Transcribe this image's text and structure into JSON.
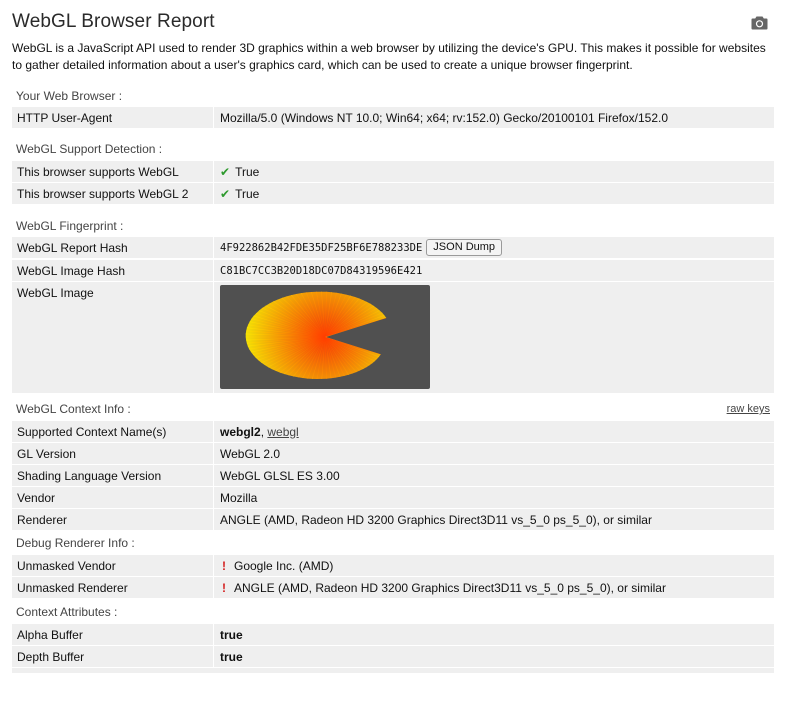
{
  "header": {
    "title": "WebGL Browser Report",
    "camera_icon": "camera-icon",
    "intro": "WebGL is a JavaScript API used to render 3D graphics within a web browser by utilizing the device's GPU. This makes it possible for websites to gather detailed information about a user's graphics card, which can be used to create a unique browser fingerprint."
  },
  "browser": {
    "section": "Your Web Browser :",
    "ua_label": "HTTP User-Agent",
    "ua_value": "Mozilla/5.0 (Windows NT 10.0; Win64; x64; rv:152.0) Gecko/20100101 Firefox/152.0"
  },
  "support": {
    "section": "WebGL Support Detection :",
    "rows": [
      {
        "label": "This browser supports WebGL",
        "check": "✔",
        "value": "True"
      },
      {
        "label": "This browser supports WebGL 2",
        "check": "✔",
        "value": "True"
      }
    ]
  },
  "fingerprint": {
    "section": "WebGL Fingerprint :",
    "report_hash_label": "WebGL Report Hash",
    "report_hash_value": "4F922862B42FDE35DF25BF6E788233DE",
    "json_dump_label": "JSON Dump",
    "image_hash_label": "WebGL Image Hash",
    "image_hash_value": "C81BC7CC3B20D18DC07D84319596E421",
    "image_label": "WebGL Image"
  },
  "context": {
    "section": "WebGL Context Info :",
    "raw_keys": "raw keys",
    "context_names_label": "Supported Context Name(s)",
    "context_primary": "webgl2",
    "context_sep": ", ",
    "context_secondary": "webgl",
    "rows": [
      {
        "label": "GL Version",
        "value": "WebGL 2.0"
      },
      {
        "label": "Shading Language Version",
        "value": "WebGL GLSL ES 3.00"
      },
      {
        "label": "Vendor",
        "value": "Mozilla"
      },
      {
        "label": "Renderer",
        "value": "ANGLE (AMD, Radeon HD 3200 Graphics Direct3D11 vs_5_0 ps_5_0), or similar"
      }
    ]
  },
  "debug": {
    "section": "Debug Renderer Info :",
    "rows": [
      {
        "label": "Unmasked Vendor",
        "mark": "!",
        "value": "Google Inc. (AMD)"
      },
      {
        "label": "Unmasked Renderer",
        "mark": "!",
        "value": "ANGLE (AMD, Radeon HD 3200 Graphics Direct3D11 vs_5_0 ps_5_0), or similar"
      }
    ]
  },
  "attributes": {
    "section": "Context Attributes :",
    "rows": [
      {
        "label": "Alpha Buffer",
        "value": "true"
      },
      {
        "label": "Depth Buffer",
        "value": "true"
      }
    ]
  },
  "colors": {
    "row_bg": "#efefef",
    "check_green": "#2e9a2e",
    "warn_red": "#d42020",
    "canvas_bg": "#505050",
    "fan_inner": "#ff3300",
    "fan_outer": "#ffee00"
  }
}
